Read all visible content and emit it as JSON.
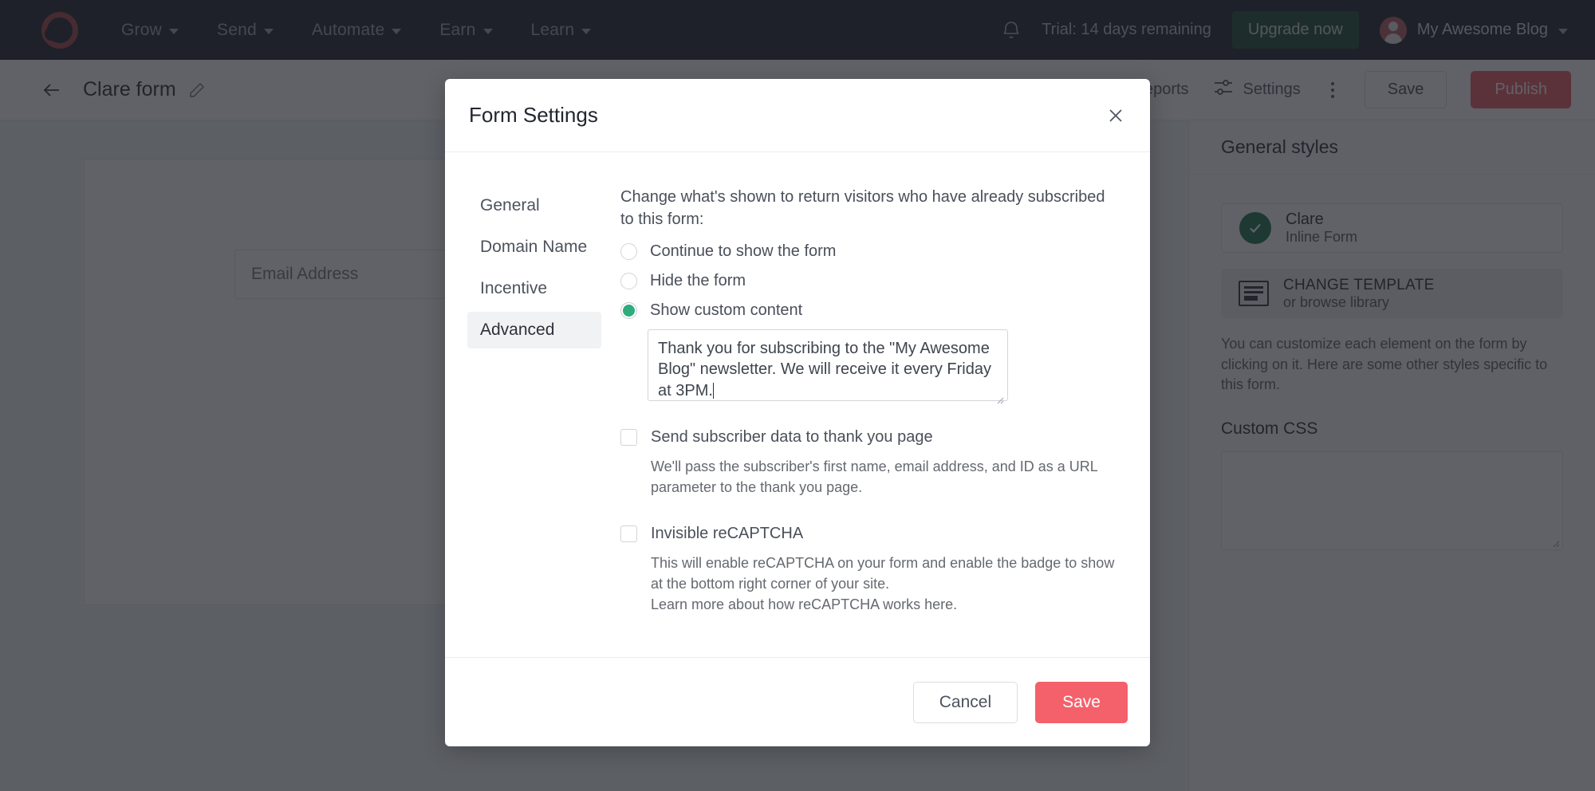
{
  "topnav": {
    "logo": "convertkit-logo-icon",
    "items": [
      {
        "label": "Grow"
      },
      {
        "label": "Send"
      },
      {
        "label": "Automate"
      },
      {
        "label": "Earn"
      },
      {
        "label": "Learn"
      }
    ],
    "notifications_icon": "bell-icon",
    "trial_text": "Trial: 14 days remaining",
    "upgrade_label": "Upgrade now",
    "account_name": "My Awesome Blog",
    "account_caret_icon": "chevron-down-icon",
    "colors": {
      "bar_bg": "#121627",
      "upgrade_bg": "#11432b",
      "logo": "#a03b3f"
    }
  },
  "subbar": {
    "back_icon": "arrow-left-icon",
    "form_title": "Clare form",
    "edit_icon": "pencil-icon",
    "reports_label": "Reports",
    "settings_icon": "sliders-icon",
    "settings_label": "Settings",
    "more_icon": "kebab-menu-icon",
    "save_label": "Save",
    "publish_label": "Publish",
    "colors": {
      "publish_bg": "#f0555f"
    }
  },
  "canvas": {
    "email_placeholder": "Email Address"
  },
  "right_panel": {
    "header": "General styles",
    "template": {
      "check_icon": "check-circle-icon",
      "name": "Clare",
      "subtitle": "Inline Form"
    },
    "change_template": {
      "icon": "template-icon",
      "title": "CHANGE TEMPLATE",
      "subtitle": "or browse library"
    },
    "help_text": "You can customize each element on the form by clicking on it. Here are some other styles specific to this form.",
    "custom_css_label": "Custom CSS",
    "custom_css_value": "",
    "resize_icon": "resize-grip-icon"
  },
  "modal": {
    "title": "Form Settings",
    "close_icon": "close-icon",
    "tabs": [
      {
        "label": "General",
        "active": false
      },
      {
        "label": "Domain Name",
        "active": false
      },
      {
        "label": "Incentive",
        "active": false
      },
      {
        "label": "Advanced",
        "active": true
      }
    ],
    "panel": {
      "intro": "Change what's shown to return visitors who have already subscribed to this form:",
      "radios": [
        {
          "label": "Continue to show the form",
          "checked": false
        },
        {
          "label": "Hide the form",
          "checked": false
        },
        {
          "label": "Show custom content",
          "checked": true
        }
      ],
      "custom_content_value": "Thank you for subscribing to the \"My Awesome Blog\" newsletter. We will receive it every Friday at 3PM.",
      "custom_content_placeholder": "",
      "checkboxes": [
        {
          "label": "Send subscriber data to thank you page",
          "checked": false,
          "hint": "We'll pass the subscriber's first name, email address, and ID as a URL parameter to the thank you page."
        },
        {
          "label": "Invisible reCAPTCHA",
          "checked": false,
          "hint": "This will enable reCAPTCHA on your form and enable the badge to show at the bottom right corner of your site.\nLearn more about how reCAPTCHA works here."
        }
      ]
    },
    "cancel_label": "Cancel",
    "save_label": "Save",
    "colors": {
      "save_bg": "#f4616b",
      "radio_selected": "#2eac7c",
      "tab_active_bg": "#f0f2f4"
    }
  }
}
